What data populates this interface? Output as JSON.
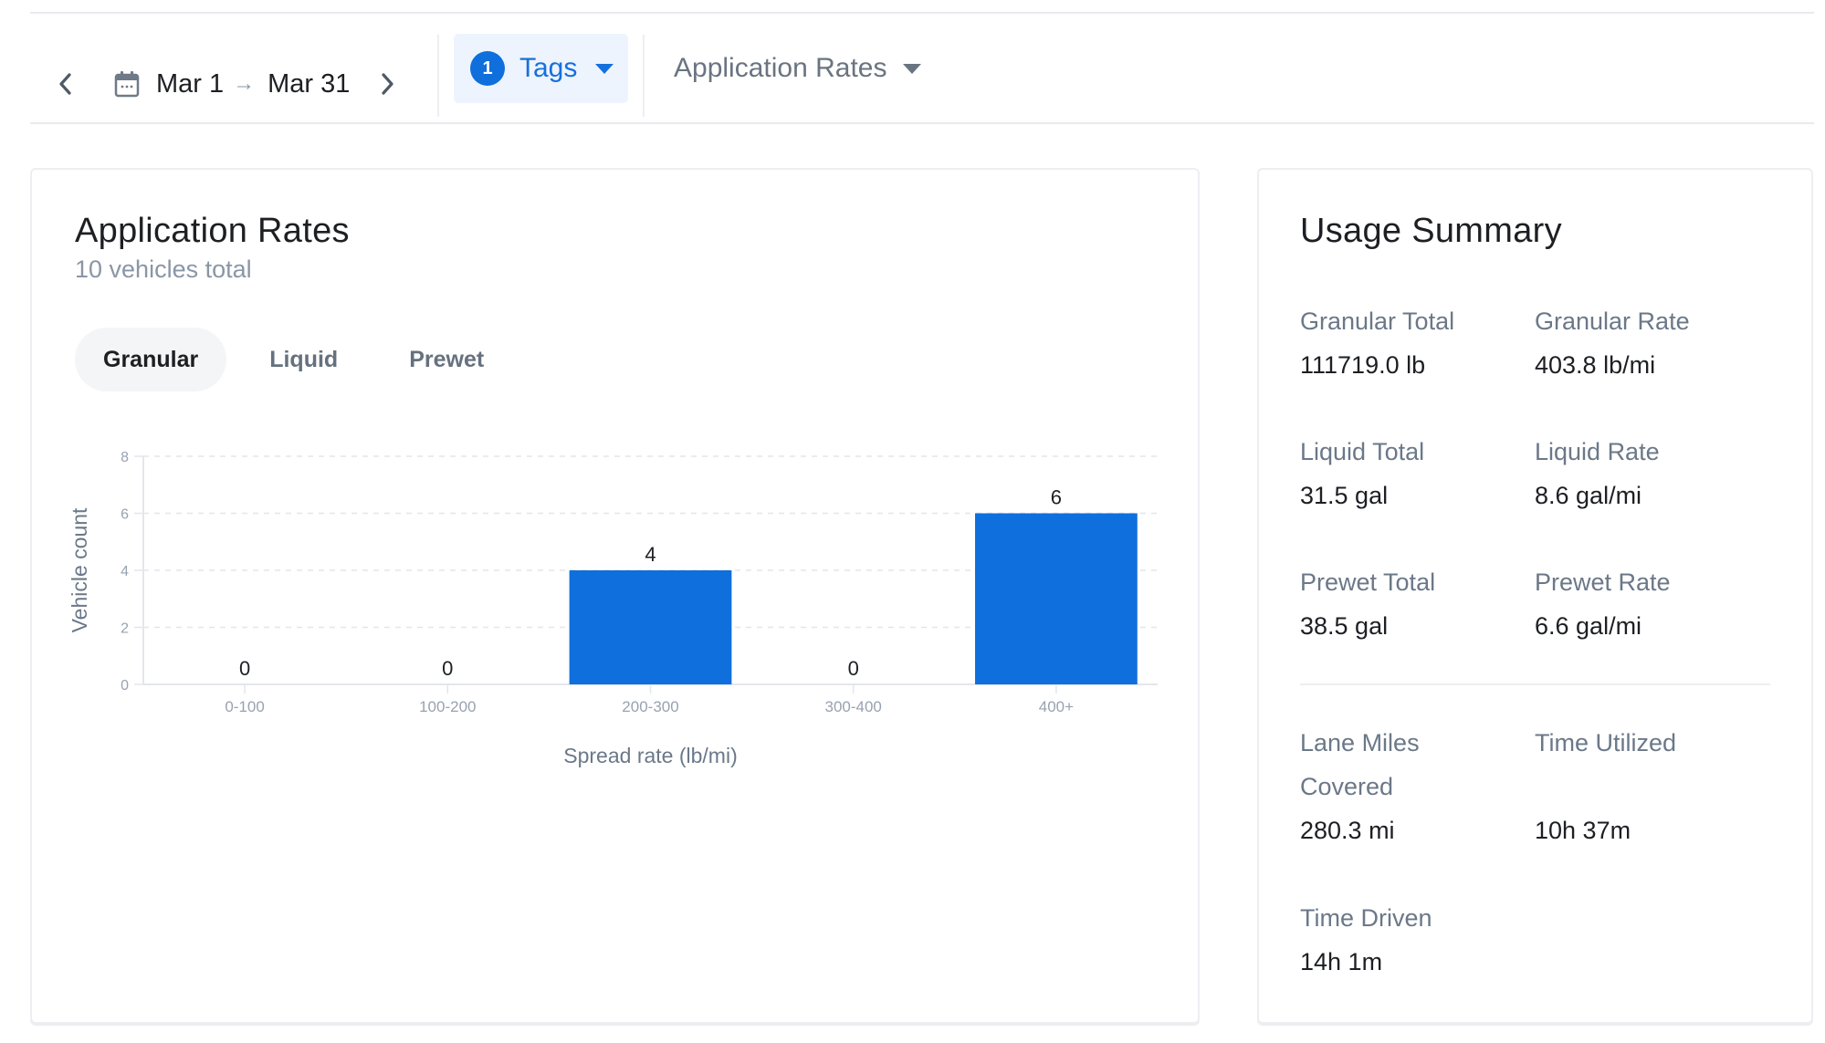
{
  "nav": {
    "prev_icon": "chevron-left-icon",
    "next_icon": "chevron-right-icon",
    "calendar_icon": "calendar-icon",
    "date_start": "Mar 1",
    "date_arrow": "→",
    "date_end": "Mar 31",
    "tags": {
      "count": "1",
      "label": "Tags"
    },
    "report_select": {
      "label": "Application Rates"
    }
  },
  "application_rates": {
    "title": "Application Rates",
    "subtitle": "10 vehicles total",
    "tabs": [
      {
        "label": "Granular",
        "active": true
      },
      {
        "label": "Liquid",
        "active": false
      },
      {
        "label": "Prewet",
        "active": false
      }
    ]
  },
  "colors": {
    "accent": "#0e6fdd",
    "bar": "#0f6fdc",
    "muted_text": "#6b7888",
    "grid": "#e3e6eb"
  },
  "chart_data": {
    "type": "bar",
    "title": "Application Rates",
    "categories": [
      "0-100",
      "100-200",
      "200-300",
      "300-400",
      "400+"
    ],
    "values": [
      0,
      0,
      4,
      0,
      6
    ],
    "data_labels": [
      "0",
      "0",
      "4",
      "0",
      "6"
    ],
    "xlabel": "Spread rate (lb/mi)",
    "ylabel": "Vehicle count",
    "ylim": [
      0,
      8
    ],
    "yticks": [
      0,
      2,
      4,
      6,
      8
    ],
    "grid": "horizontal-dashed",
    "legend": "none"
  },
  "usage_summary": {
    "title": "Usage Summary",
    "metrics": [
      {
        "label": "Granular Total",
        "value": "111719.0 lb"
      },
      {
        "label": "Granular Rate",
        "value": "403.8 lb/mi"
      },
      {
        "label": "Liquid Total",
        "value": "31.5 gal"
      },
      {
        "label": "Liquid Rate",
        "value": "8.6 gal/mi"
      },
      {
        "label": "Prewet Total",
        "value": "38.5 gal"
      },
      {
        "label": "Prewet Rate",
        "value": "6.6 gal/mi"
      },
      {
        "label": "Lane Miles Covered",
        "value": "280.3 mi"
      },
      {
        "label": "Time Utilized",
        "value": "10h 37m"
      },
      {
        "label": "Time Driven",
        "value": "14h 1m"
      }
    ]
  }
}
